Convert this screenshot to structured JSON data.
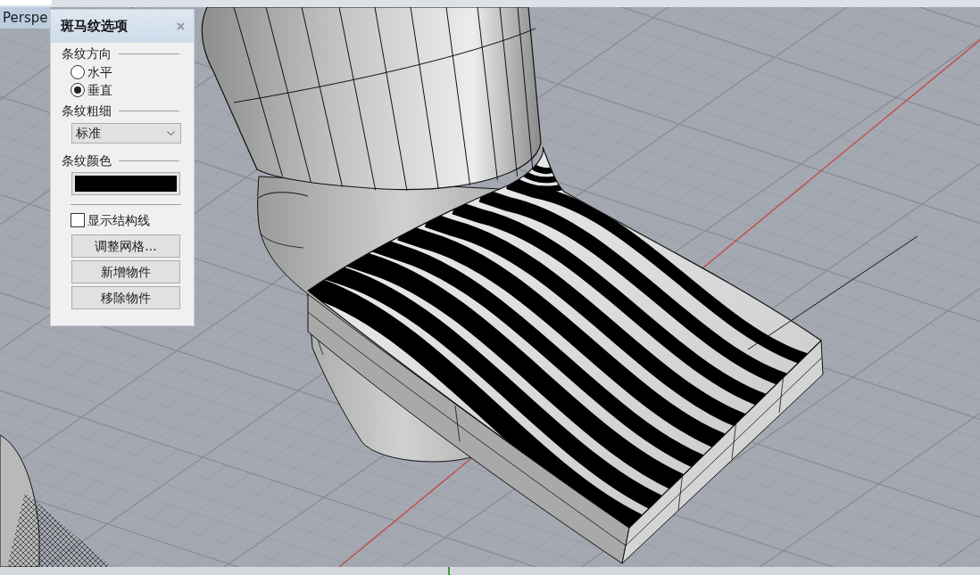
{
  "viewport": {
    "tab_label": "Perspe"
  },
  "zebra_panel": {
    "title": "斑马纹选项",
    "stripe_direction": {
      "label": "条纹方向",
      "options": [
        {
          "label": "水平",
          "selected": false
        },
        {
          "label": "垂直",
          "selected": true
        }
      ]
    },
    "stripe_thickness": {
      "label": "条纹粗细",
      "value": "标准"
    },
    "stripe_color": {
      "label": "条纹颜色",
      "color": "#000000"
    },
    "show_structure_lines": {
      "label": "显示结构线",
      "checked": false
    },
    "buttons": [
      "调整网格...",
      "新增物件",
      "移除物件"
    ]
  }
}
